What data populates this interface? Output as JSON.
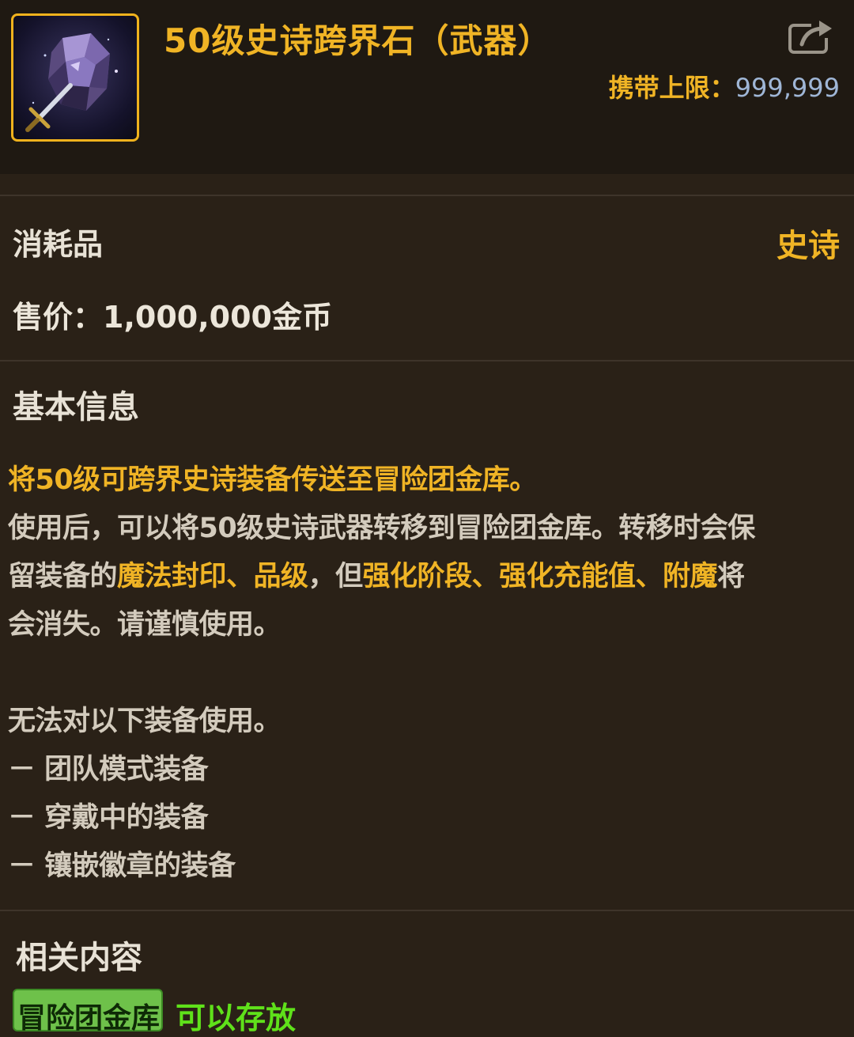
{
  "header": {
    "title": "50级史诗跨界石（武器）",
    "icon": "crystal-stone-with-sword-icon",
    "share_icon": "share-export-icon",
    "carry_limit_label": "携带上限：",
    "carry_limit_value": "999,999"
  },
  "summary": {
    "item_type": "消耗品",
    "rarity": "史诗",
    "price": "售价：1,000,000金币"
  },
  "basic_info": {
    "title": "基本信息",
    "headline": "将50级可跨界史诗装备传送至冒险团金库。",
    "description": {
      "line1": "使用后，可以将50级史诗武器转移到冒险团金库。转移时会保",
      "line2_a": "留装备的",
      "line2_b": "魔法封印、品级",
      "line2_c": "，但",
      "line2_d": "强化阶段、强化充能值、附魔",
      "line2_e": "将",
      "line3": "会消失。请谨慎使用。"
    },
    "restriction_title": "无法对以下装备使用。",
    "restrictions": [
      "－ 团队模式装备",
      "－ 穿戴中的装备",
      "－ 镶嵌徽章的装备"
    ]
  },
  "related": {
    "title": "相关内容",
    "tag_label": "冒险团金库",
    "tag_status": "可以存放"
  },
  "colors": {
    "background": "#2a2117",
    "header_background": "#1f1912",
    "accent_gold": "#f0b425",
    "value_blue": "#9fb6d6",
    "status_green": "#5fe11a",
    "tag_green": "#6ec14a"
  }
}
